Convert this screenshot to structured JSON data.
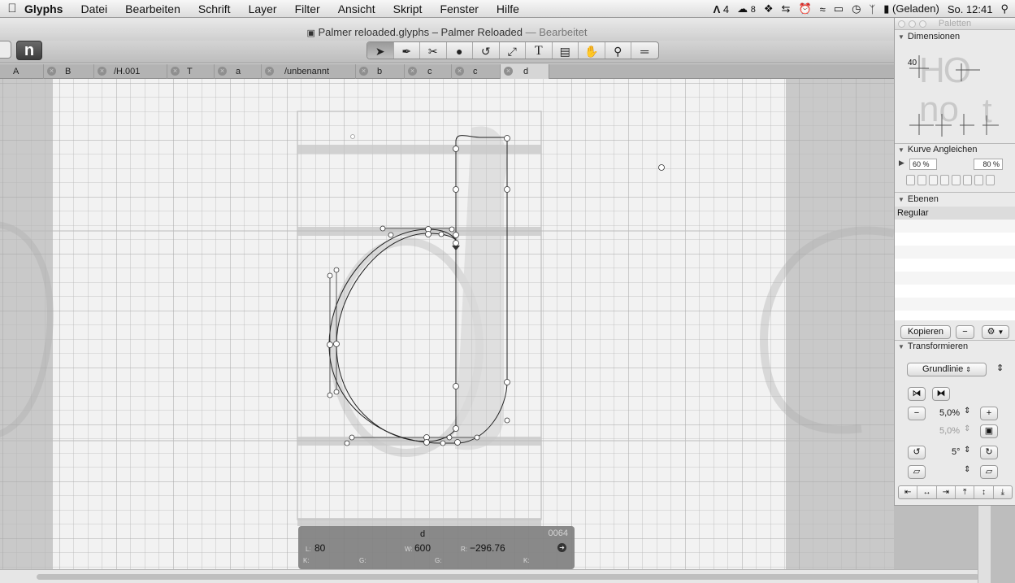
{
  "menubar": {
    "apple": "",
    "app": "Glyphs",
    "items": [
      "Datei",
      "Bearbeiten",
      "Schrift",
      "Layer",
      "Filter",
      "Ansicht",
      "Skript",
      "Fenster",
      "Hilfe"
    ],
    "status": {
      "adobe": "4",
      "cc": "8",
      "battery": "(Geladen)",
      "clock": "So. 12:41"
    }
  },
  "window": {
    "title": "Palmer reloaded.glyphs – Palmer Reloaded",
    "title_suffix": "— Bearbeitet",
    "n_button": "n"
  },
  "tabs": [
    {
      "label": "A",
      "active": false
    },
    {
      "label": "B",
      "active": false
    },
    {
      "label": "/H.001",
      "active": false
    },
    {
      "label": "T",
      "active": false
    },
    {
      "label": "a",
      "active": false
    },
    {
      "label": "/unbenannt",
      "active": false
    },
    {
      "label": "b",
      "active": false
    },
    {
      "label": "c",
      "active": false
    },
    {
      "label": "c",
      "active": false
    },
    {
      "label": "d",
      "active": true
    }
  ],
  "glyph_info": {
    "name": "d",
    "unicode": "0064",
    "lsb_label": "L:",
    "lsb": "80",
    "width_label": "W:",
    "width": "600",
    "rsb_label": "R:",
    "rsb": "−296.76",
    "k_label": "K:",
    "g_label": "G:",
    "g2_label": "G:",
    "k2_label": "K:"
  },
  "palette": {
    "title": "Paletten",
    "dimensions": {
      "header": "Dimensionen",
      "value": "40",
      "sample_upper": "HO",
      "sample_lower": "no",
      "sample_t": "t"
    },
    "curve": {
      "header": "Kurve Angleichen",
      "value1": "60 %",
      "value2": "80 %"
    },
    "layers": {
      "header": "Ebenen",
      "items": [
        "Regular"
      ],
      "copy_button": "Kopieren",
      "minus_button": "−"
    },
    "transform": {
      "header": "Transformieren",
      "origin": "Grundlinie",
      "scale_x": "5,0%",
      "scale_y": "5,0%",
      "rotate": "5°"
    }
  }
}
